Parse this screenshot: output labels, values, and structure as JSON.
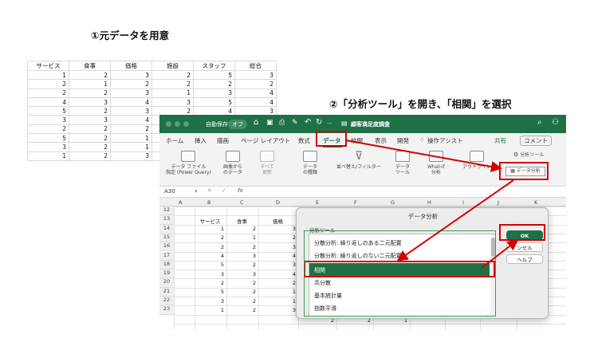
{
  "captions": {
    "step1": "①元データを用意",
    "step2": "②「分析ツール」を開き、「相関」を選択"
  },
  "sheet1": {
    "headers": [
      "サービス",
      "食事",
      "価格",
      "施設",
      "スタッフ",
      "総合"
    ],
    "rows": [
      [
        "1",
        "2",
        "3",
        "2",
        "5",
        "3"
      ],
      [
        "2",
        "1",
        "2",
        "2",
        "2",
        "2"
      ],
      [
        "2",
        "2",
        "3",
        "1",
        "3",
        "4"
      ],
      [
        "4",
        "3",
        "4",
        "3",
        "5",
        "4"
      ],
      [
        "5",
        "2",
        "3",
        "2",
        "4",
        "3"
      ],
      [
        "3",
        "3",
        "4",
        "",
        "",
        ""
      ],
      [
        "2",
        "2",
        "2",
        "",
        "",
        ""
      ],
      [
        "5",
        "2",
        "1",
        "",
        "",
        ""
      ],
      [
        "3",
        "2",
        "1",
        "",
        "",
        ""
      ],
      [
        "1",
        "2",
        "3",
        "",
        "",
        ""
      ]
    ]
  },
  "excel": {
    "autosave_label": "自動保存",
    "autosave_state": "オフ",
    "more": "···",
    "doc_title": "顧客満足度調査",
    "tabs": [
      "ホーム",
      "挿入",
      "描画",
      "ページ レイアウト",
      "数式",
      "データ",
      "校閲",
      "表示",
      "開発"
    ],
    "assist": "操作アシスト",
    "share": "共有",
    "comment": "コメント",
    "ribbon": {
      "get_data": [
        "データ ファイル",
        "指定 (Power Query)"
      ],
      "from_image": [
        "画像から",
        "のデータ"
      ],
      "refresh_all": [
        "すべて",
        "更新"
      ],
      "data_types": [
        "データ",
        "の種類"
      ],
      "sort_filter": "並べ替え/フィルター",
      "data_tools": [
        "データ",
        "ツール"
      ],
      "what_if": [
        "What-if",
        "分析"
      ],
      "outline": "アウトライン",
      "analysis_group": "分析ツール",
      "analysis_button": "データ分析"
    },
    "namebox": "A30",
    "fx": "fx",
    "columns": [
      "A",
      "B",
      "C",
      "D",
      "E",
      "F",
      "G",
      "H",
      "I",
      "J",
      "K"
    ],
    "row_numbers": [
      "12",
      "13",
      "14",
      "15",
      "16",
      "17",
      "18",
      "19",
      "20",
      "21",
      "22",
      "23"
    ],
    "table_headers": [
      "サービス",
      "食事",
      "価格"
    ],
    "table_rows": [
      [
        "1",
        "2",
        "3"
      ],
      [
        "2",
        "1",
        "2"
      ],
      [
        "2",
        "2",
        "3"
      ],
      [
        "4",
        "3",
        "4"
      ],
      [
        "5",
        "2",
        "3"
      ],
      [
        "3",
        "3",
        "4"
      ],
      [
        "2",
        "2",
        "2"
      ],
      [
        "5",
        "2",
        "1"
      ],
      [
        "3",
        "2",
        "1"
      ],
      [
        "1",
        "2",
        "3"
      ]
    ],
    "hidden_row": [
      "2",
      "2",
      "1"
    ]
  },
  "dialog": {
    "title": "データ分析",
    "list_label": "分析ツール",
    "items": [
      "分散分析: 繰り返しのある二元配置",
      "分散分析: 繰り返しのない二元配置",
      "相関",
      "共分散",
      "基本統計量",
      "指数平滑"
    ],
    "selected_index": 2,
    "ok": "OK",
    "cancel": "ンセル",
    "help": "ヘルプ"
  },
  "colors": {
    "excel_green": "#1e7145",
    "highlight_red": "#d40000",
    "selection_green": "#1e7145"
  }
}
